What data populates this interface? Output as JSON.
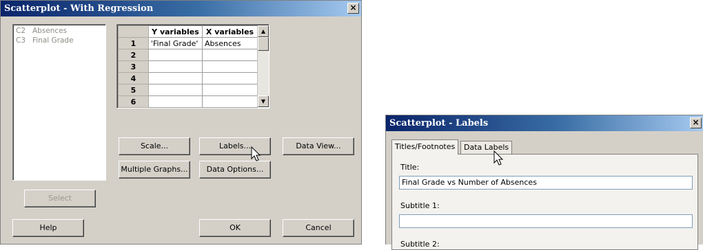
{
  "dialog1": {
    "title": "Scatterplot - With Regression",
    "close_glyph": "×",
    "variables": [
      {
        "col": "C2",
        "name": "Absences"
      },
      {
        "col": "C3",
        "name": "Final Grade"
      }
    ],
    "grid": {
      "headers": [
        "Y variables",
        "X variables"
      ],
      "rows": [
        {
          "n": "1",
          "y": "'Final Grade'",
          "x": "Absences"
        },
        {
          "n": "2",
          "y": "",
          "x": ""
        },
        {
          "n": "3",
          "y": "",
          "x": ""
        },
        {
          "n": "4",
          "y": "",
          "x": ""
        },
        {
          "n": "5",
          "y": "",
          "x": ""
        },
        {
          "n": "6",
          "y": "",
          "x": ""
        }
      ]
    },
    "buttons": {
      "scale": "Scale...",
      "labels": "Labels...",
      "data_view": "Data View...",
      "multiple_graphs": "Multiple Graphs...",
      "data_options": "Data Options...",
      "select": "Select",
      "help": "Help",
      "ok": "OK",
      "cancel": "Cancel"
    }
  },
  "dialog2": {
    "title": "Scatterplot - Labels",
    "close_glyph": "×",
    "tabs": [
      "Titles/Footnotes",
      "Data Labels"
    ],
    "title_label": "Title:",
    "title_value": "Final Grade vs Number of Absences",
    "subtitle1_label": "Subtitle 1:",
    "subtitle1_value": "",
    "subtitle2_label": "Subtitle 2:"
  },
  "colors": {
    "titlebar_start": "#0a246a",
    "titlebar_end": "#a6caf0",
    "dialog_face": "#d4d0c8"
  }
}
